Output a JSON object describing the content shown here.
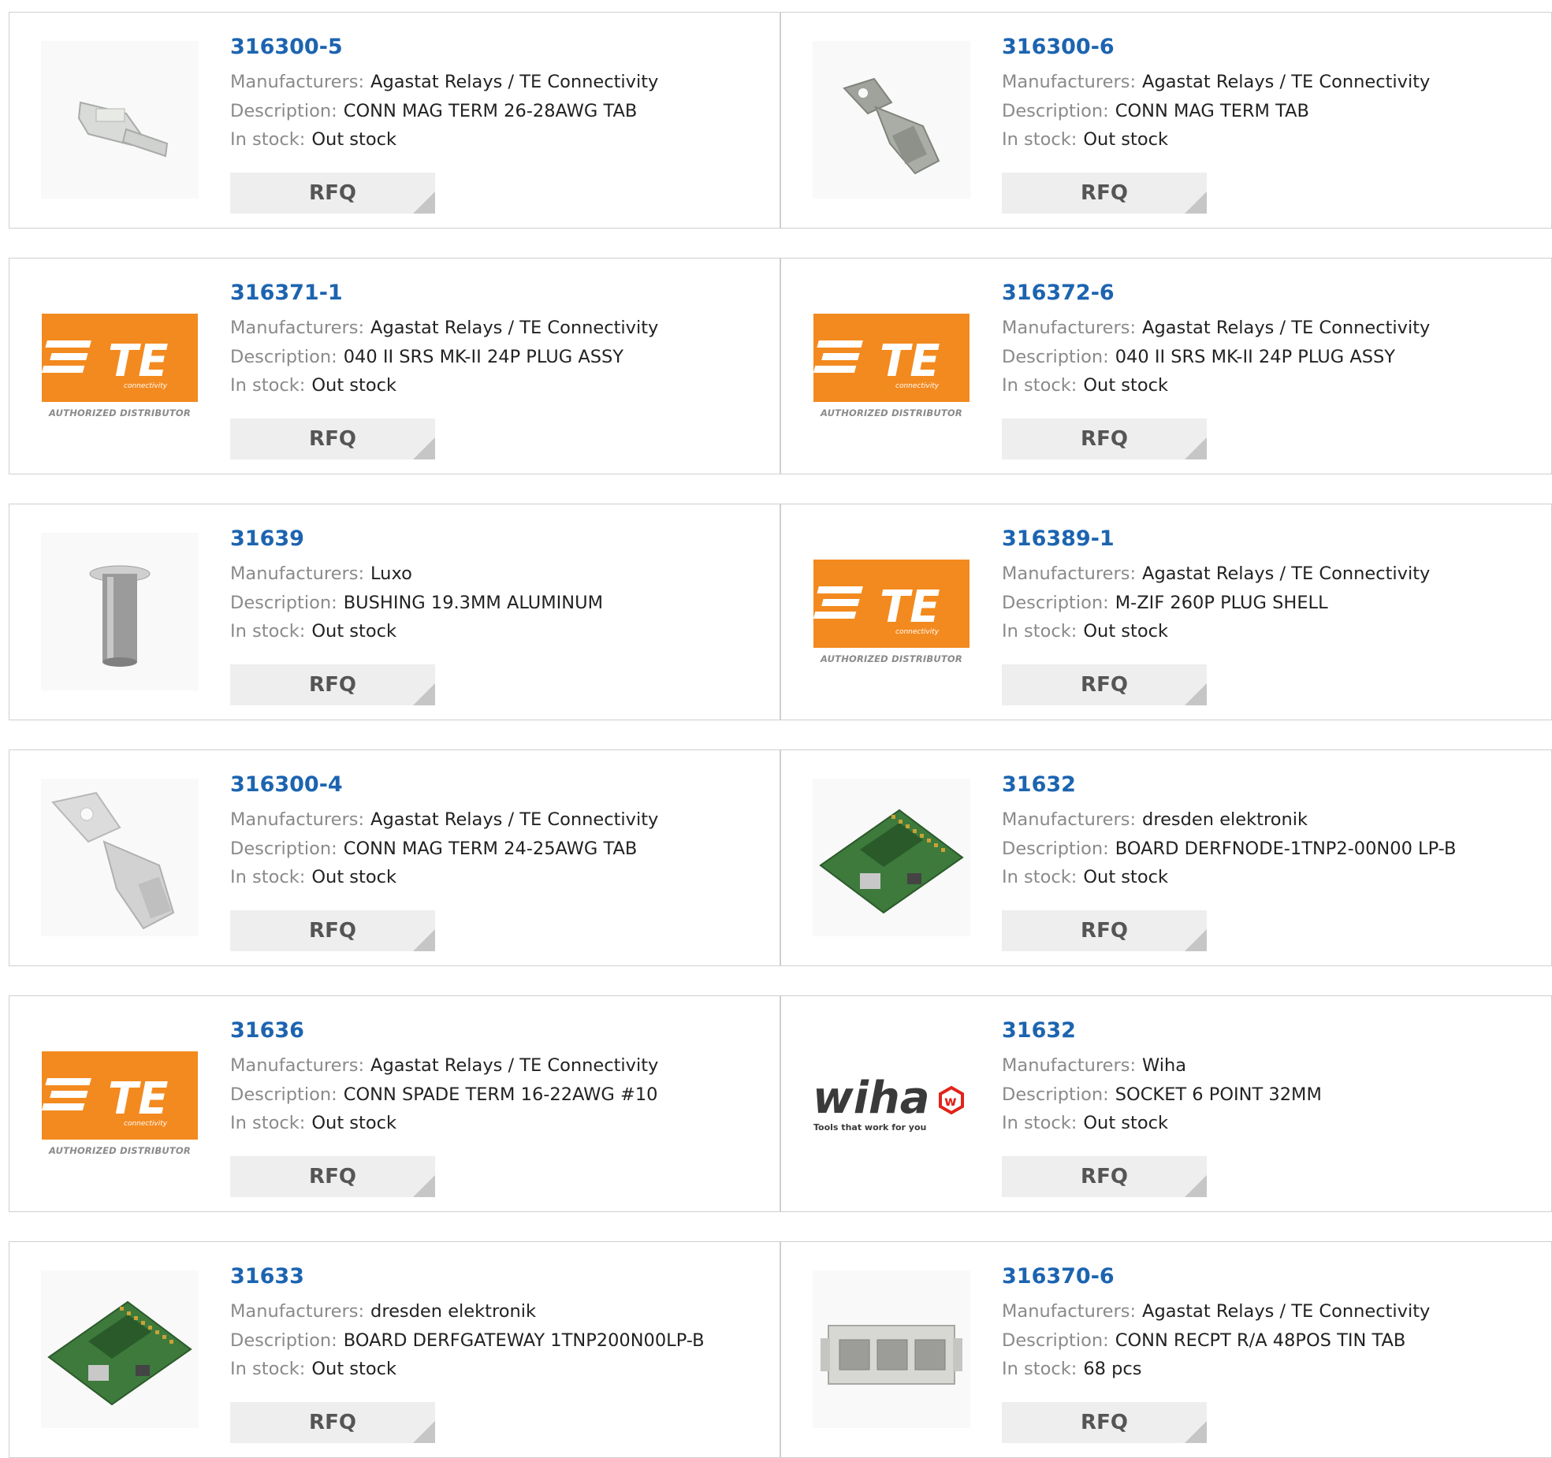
{
  "labels": {
    "manufacturers": "Manufacturers:",
    "description": "Description:",
    "in_stock": "In stock:",
    "rfq": "RFQ"
  },
  "te_logo": {
    "brand": "TE",
    "sub": "connectivity",
    "authorized": "AUTHORIZED DISTRIBUTOR"
  },
  "wiha_logo": {
    "brand": "wiha",
    "tagline": "Tools that work for you"
  },
  "colors": {
    "part_number": "#1c64b0",
    "te_orange": "#f38a1f",
    "wiha_red": "#e2231a",
    "rfq_bg": "#eeeeee"
  },
  "products": [
    {
      "part_number": "316300-5",
      "manufacturer": "Agastat Relays / TE Connectivity",
      "description": "CONN MAG TERM 26-28AWG TAB",
      "stock": "Out stock",
      "image": "terminal-tab-small-image"
    },
    {
      "part_number": "316300-6",
      "manufacturer": "Agastat Relays / TE Connectivity",
      "description": "CONN MAG TERM TAB",
      "stock": "Out stock",
      "image": "terminal-tab-image"
    },
    {
      "part_number": "316371-1",
      "manufacturer": "Agastat Relays / TE Connectivity",
      "description": "040 II SRS MK-II 24P PLUG ASSY",
      "stock": "Out stock",
      "image": "te-logo"
    },
    {
      "part_number": "316372-6",
      "manufacturer": "Agastat Relays / TE Connectivity",
      "description": "040 II SRS MK-II 24P PLUG ASSY",
      "stock": "Out stock",
      "image": "te-logo"
    },
    {
      "part_number": "31639",
      "manufacturer": "Luxo",
      "description": "BUSHING 19.3MM ALUMINUM",
      "stock": "Out stock",
      "image": "bushing-image"
    },
    {
      "part_number": "316389-1",
      "manufacturer": "Agastat Relays / TE Connectivity",
      "description": "M-ZIF 260P PLUG SHELL",
      "stock": "Out stock",
      "image": "te-logo"
    },
    {
      "part_number": "316300-4",
      "manufacturer": "Agastat Relays / TE Connectivity",
      "description": "CONN MAG TERM 24-25AWG TAB",
      "stock": "Out stock",
      "image": "terminal-tab-large-image"
    },
    {
      "part_number": "31632",
      "manufacturer": "dresden elektronik",
      "description": "BOARD DERFNODE-1TNP2-00N00 LP-B",
      "stock": "Out stock",
      "image": "circuit-board-image"
    },
    {
      "part_number": "31636",
      "manufacturer": "Agastat Relays / TE Connectivity",
      "description": "CONN SPADE TERM 16-22AWG #10",
      "stock": "Out stock",
      "image": "te-logo"
    },
    {
      "part_number": "31632",
      "manufacturer": "Wiha",
      "description": "SOCKET 6 POINT 32MM",
      "stock": "Out stock",
      "image": "wiha-logo"
    },
    {
      "part_number": "31633",
      "manufacturer": "dresden elektronik",
      "description": "BOARD DERFGATEWAY 1TNP200N00LP-B",
      "stock": "Out stock",
      "image": "circuit-board-image"
    },
    {
      "part_number": "316370-6",
      "manufacturer": "Agastat Relays / TE Connectivity",
      "description": "CONN RECPT R/A 48POS TIN TAB",
      "stock": "68 pcs",
      "image": "connector-receptacle-image"
    }
  ]
}
